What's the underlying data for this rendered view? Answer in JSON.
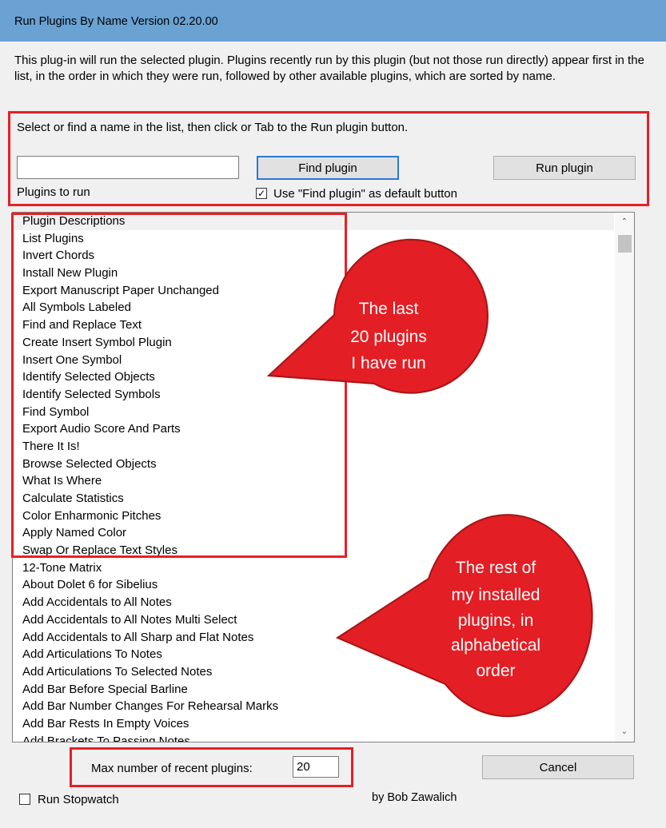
{
  "window": {
    "title": "Run Plugins By Name  Version 02.20.00"
  },
  "description": "This plug-in will run the selected plugin. Plugins recently run by this plugin (but not those run directly) appear first in the list, in the order in which they were run, followed by other available plugins, which are sorted by name.",
  "instruction": "Select or find a name in the list, then click or Tab to the Run plugin button.",
  "search": {
    "value": "",
    "label": "Plugins to run"
  },
  "buttons": {
    "find": "Find plugin",
    "run": "Run plugin",
    "cancel": "Cancel"
  },
  "default_button_checkbox": {
    "label": "Use \"Find plugin\" as default button",
    "checked": true
  },
  "plugin_list": [
    "Plugin Descriptions",
    "List Plugins",
    "Invert Chords",
    "Install New Plugin",
    "Export Manuscript Paper Unchanged",
    "All Symbols Labeled",
    "Find and Replace Text",
    "Create Insert Symbol Plugin",
    "Insert One Symbol",
    "Identify Selected Objects",
    "Identify Selected Symbols",
    "Find Symbol",
    "Export Audio Score And Parts",
    "There It Is!",
    "Browse Selected Objects",
    "What Is Where",
    "Calculate Statistics",
    "Color Enharmonic Pitches",
    "Apply Named Color",
    "Swap Or Replace Text Styles",
    "12-Tone Matrix",
    "About Dolet 6 for Sibelius",
    "Add Accidentals to All Notes",
    "Add Accidentals to All Notes Multi Select",
    "Add Accidentals to All Sharp and Flat Notes",
    "Add Articulations To Notes",
    "Add Articulations To Selected Notes",
    "Add Bar Before Special Barline",
    "Add Bar Number Changes For Rehearsal Marks",
    "Add Bar Rests In Empty Voices",
    "Add Brackets To Passing Notes"
  ],
  "max_recent": {
    "label": "Max number of recent plugins:",
    "value": "20"
  },
  "stopwatch": {
    "label": "Run Stopwatch",
    "checked": false
  },
  "credit": "by Bob Zawalich",
  "callouts": {
    "recent": [
      "The last",
      "20 plugins",
      "I have run"
    ],
    "rest": [
      "The rest of",
      "my installed",
      "plugins, in",
      "alphabetical",
      "order"
    ]
  },
  "colors": {
    "titlebar": "#6aa2d4",
    "highlight": "#e81f24",
    "callout": "#e31e24",
    "default_button_border": "#2b78d4"
  }
}
